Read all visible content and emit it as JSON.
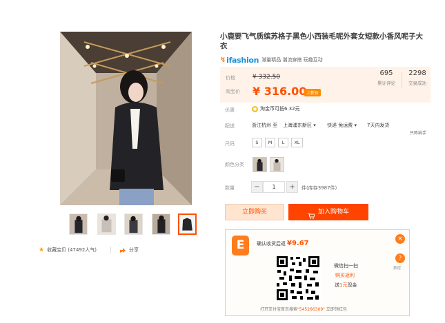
{
  "product": {
    "title": "小鹿要飞气质缤苏格子黑色小西装毛呢外套女短款小香风呢子大衣",
    "brand_name": "ifashion",
    "brand_tags": "潮量精品  潮流穿搭  玩趣互动"
  },
  "pricing": {
    "price_label": "价格",
    "original_price": "¥ 332.50",
    "promo_label": "淘宝价",
    "promo_price": "¥ 316.00",
    "promo_tag": "上新价",
    "reviews_count": "695",
    "reviews_label": "累计评论",
    "sales_count": "2298",
    "sales_label": "交易成功"
  },
  "offers": {
    "label": "优惠",
    "coin_text": "淘金币可抵6.32元"
  },
  "delivery": {
    "label": "配送",
    "from": "浙江杭州 至",
    "to": "上海浦东新区 ▾",
    "shipping": "快递 免运费 ▾",
    "returns": "7天内发货",
    "guarantee": "只赊纳手"
  },
  "sizes": {
    "label": "尺码",
    "options": [
      "S",
      "M",
      "L",
      "XL"
    ]
  },
  "colors": {
    "label": "颜色分类"
  },
  "quantity": {
    "label": "数量",
    "minus": "−",
    "value": "1",
    "plus": "+",
    "stock": "件(库存3987件)"
  },
  "actions": {
    "buy_now": "立即购买",
    "add_to_cart": "加入购物车"
  },
  "favorites": {
    "star": "★",
    "text": "收藏宝贝 (47492人气)",
    "share": "分享"
  },
  "coupon": {
    "logo": "E",
    "head": "确认收货后返",
    "amount": "¥9.67",
    "close": "×",
    "help": "?",
    "help_label": "教程",
    "scan_1": "微信扫一扫",
    "scan_2": "购买返利",
    "scan_3_a": "送",
    "scan_3_b": "1元",
    "scan_3_c": "现金",
    "foot_a": "打开支付宝首页搜索",
    "foot_code": "\"545266309\"",
    "foot_b": "  立即领红包"
  },
  "colors_hex": {
    "accent": "#ff5000",
    "cart_button": "#ff4400",
    "price_bg": "#fff2e8"
  }
}
